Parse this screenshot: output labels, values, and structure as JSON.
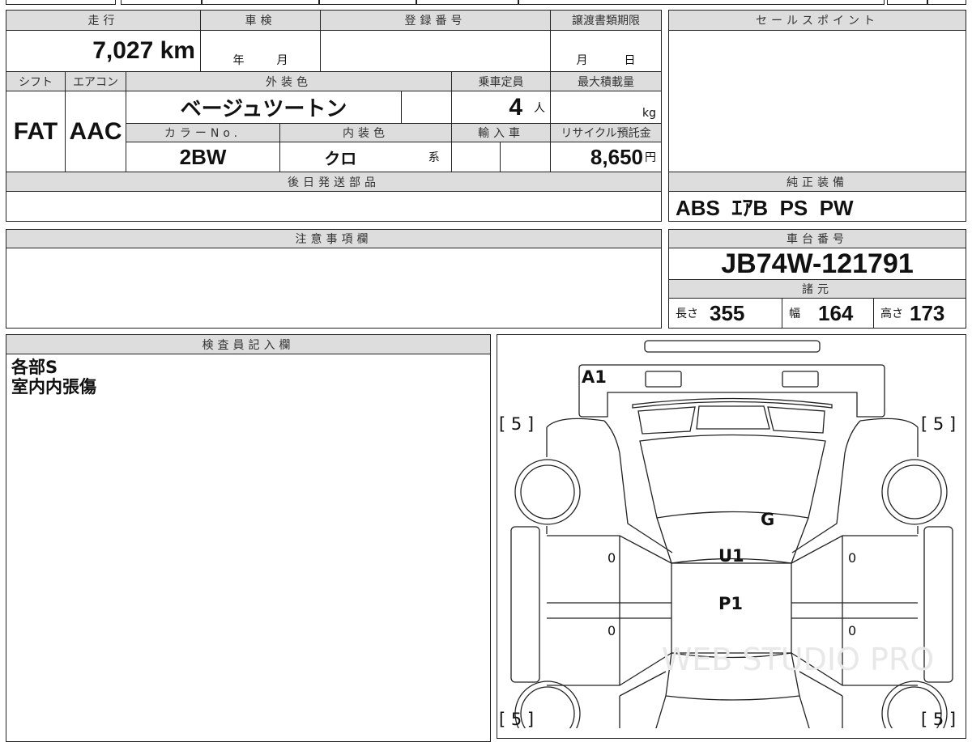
{
  "main_table": {
    "mileage_label": "走行",
    "mileage_value": "7,027 km",
    "shaken_label": "車検",
    "shaken_year": "年",
    "shaken_month": "月",
    "reg_no_label": "登録番号",
    "transfer_deadline_label": "譲渡書類期限",
    "transfer_month": "月",
    "transfer_day": "日",
    "shift_label": "シフト",
    "shift_value": "FAT",
    "aircon_label": "エアコン",
    "aircon_value": "AAC",
    "exterior_color_label": "外装色",
    "exterior_color_value": "ベージュツートン",
    "capacity_label": "乗車定員",
    "capacity_value": "4",
    "capacity_unit": "人",
    "max_load_label": "最大積載量",
    "max_load_unit": "kg",
    "color_no_label": "カラーNo.",
    "color_no_value": "2BW",
    "interior_color_label": "内装色",
    "interior_color_value": "クロ",
    "interior_color_suffix": "系",
    "import_label": "輸入車",
    "recycle_label": "リサイクル預託金",
    "recycle_value": "8,650",
    "recycle_unit": "円",
    "later_parts_label": "後日発送部品"
  },
  "sales_point": {
    "label": "セールスポイント"
  },
  "equipment": {
    "label": "純正装備",
    "value": "ABS  ｴｱB  PS  PW"
  },
  "notes": {
    "label": "注意事項欄"
  },
  "chassis": {
    "label": "車台番号",
    "value": "JB74W-121791",
    "specs_label": "諸元",
    "length_label": "長さ",
    "length_value": "355",
    "width_label": "幅",
    "width_value": "164",
    "height_label": "高さ",
    "height_value": "173"
  },
  "inspector": {
    "label": "検査員記入欄",
    "lines": [
      "各部S",
      "室内内張傷"
    ]
  },
  "diagram": {
    "marks": {
      "front": "A1",
      "roof_front": "G",
      "roof": "U1",
      "roof_rear": "P1"
    },
    "tire_tread": [
      "[ 5 ]",
      "[ 5 ]",
      "[ 5 ]",
      "[ 5 ]"
    ],
    "door_marks": [
      "0",
      "0",
      "0",
      "0"
    ],
    "watermark": "WEB STUDIO PRO"
  }
}
